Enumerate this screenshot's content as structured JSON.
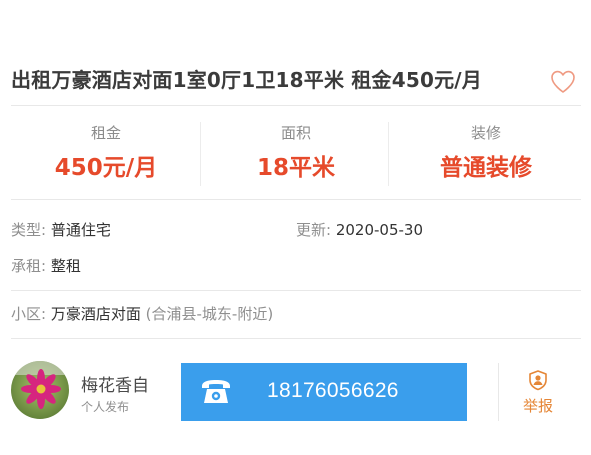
{
  "listing": {
    "title": "出租万豪酒店对面1室0厅1卫18平米 租金450元/月"
  },
  "stats": [
    {
      "label": "租金",
      "value": "450元/月"
    },
    {
      "label": "面积",
      "value": "18平米"
    },
    {
      "label": "装修",
      "value": "普通装修"
    }
  ],
  "details": {
    "type_key": "类型:",
    "type_value": "普通住宅",
    "updated_key": "更新:",
    "updated_value": "2020-05-30",
    "lease_key": "承租:",
    "lease_value": "整租",
    "community_key": "小区:",
    "community_value": "万豪酒店对面",
    "community_area": "(合浦县-城东-附近)"
  },
  "contact": {
    "poster_name": "梅花香自",
    "poster_role": "个人发布",
    "phone": "18176056626",
    "report_label": "举报"
  },
  "colors": {
    "accent_red": "#e64a2b",
    "phone_blue": "#3a9eec",
    "report_orange": "#e58636",
    "favorite_outline": "#ef9a82"
  },
  "icons": {
    "favorite": "heart-outline-icon",
    "phone": "telephone-icon",
    "report": "report-shield-icon"
  }
}
